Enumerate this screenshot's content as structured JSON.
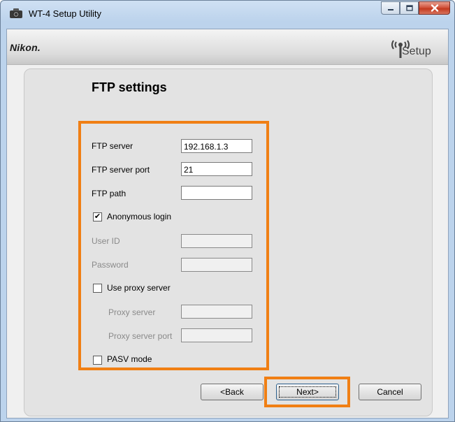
{
  "window": {
    "title": "WT-4 Setup Utility"
  },
  "header": {
    "brand": "Nikon.",
    "setup_logo_text": "Setup"
  },
  "page": {
    "title": "FTP settings"
  },
  "form": {
    "ftp_server": {
      "label": "FTP server",
      "value": "192.168.1.3"
    },
    "ftp_server_port": {
      "label": "FTP server port",
      "value": "21"
    },
    "ftp_path": {
      "label": "FTP path",
      "value": ""
    },
    "anonymous_login": {
      "label": "Anonymous login",
      "checked": true,
      "mark": "✔"
    },
    "user_id": {
      "label": "User ID",
      "value": ""
    },
    "password": {
      "label": "Password",
      "value": ""
    },
    "use_proxy_server": {
      "label": "Use proxy server",
      "checked": false
    },
    "proxy_server": {
      "label": "Proxy server",
      "value": ""
    },
    "proxy_server_port": {
      "label": "Proxy server port",
      "value": ""
    },
    "pasv_mode": {
      "label": "PASV mode",
      "checked": false
    }
  },
  "buttons": {
    "back": "<Back",
    "next": "Next>",
    "cancel": "Cancel"
  },
  "icons": {
    "app": "camera-icon",
    "minimize": "minimize-icon",
    "maximize": "maximize-icon",
    "close": "close-icon",
    "setup": "wireless-setup-icon"
  },
  "colors": {
    "highlight": "#f07f14",
    "titlebar": "#bcd3ec",
    "close_button": "#c3391f"
  }
}
